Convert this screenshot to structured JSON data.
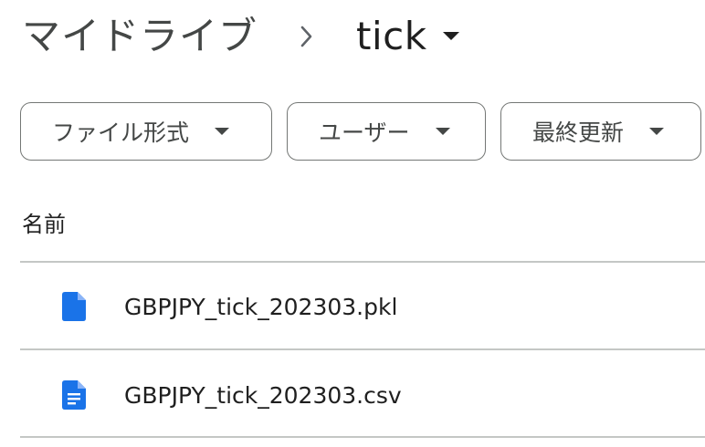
{
  "breadcrumb": {
    "root": "マイドライブ",
    "separator_icon": "chevron-right-icon",
    "current": "tick",
    "caret_icon": "arrow-drop-down-icon"
  },
  "filters": [
    {
      "label": "ファイル形式",
      "icon": "arrow-drop-down-icon"
    },
    {
      "label": "ユーザー",
      "icon": "arrow-drop-down-icon"
    },
    {
      "label": "最終更新",
      "icon": "arrow-drop-down-icon"
    }
  ],
  "list": {
    "column_header": "名前",
    "files": [
      {
        "name": "GBPJPY_tick_202303.pkl",
        "icon": "generic-file-icon",
        "icon_color": "#1a73e8"
      },
      {
        "name": "GBPJPY_tick_202303.csv",
        "icon": "document-file-icon",
        "icon_color": "#1a73e8"
      }
    ]
  },
  "colors": {
    "text_primary": "#1f1f1f",
    "text_secondary": "#444746",
    "chip_border": "#747775",
    "divider": "#c4c7c5",
    "file_icon_blue": "#1a73e8"
  }
}
